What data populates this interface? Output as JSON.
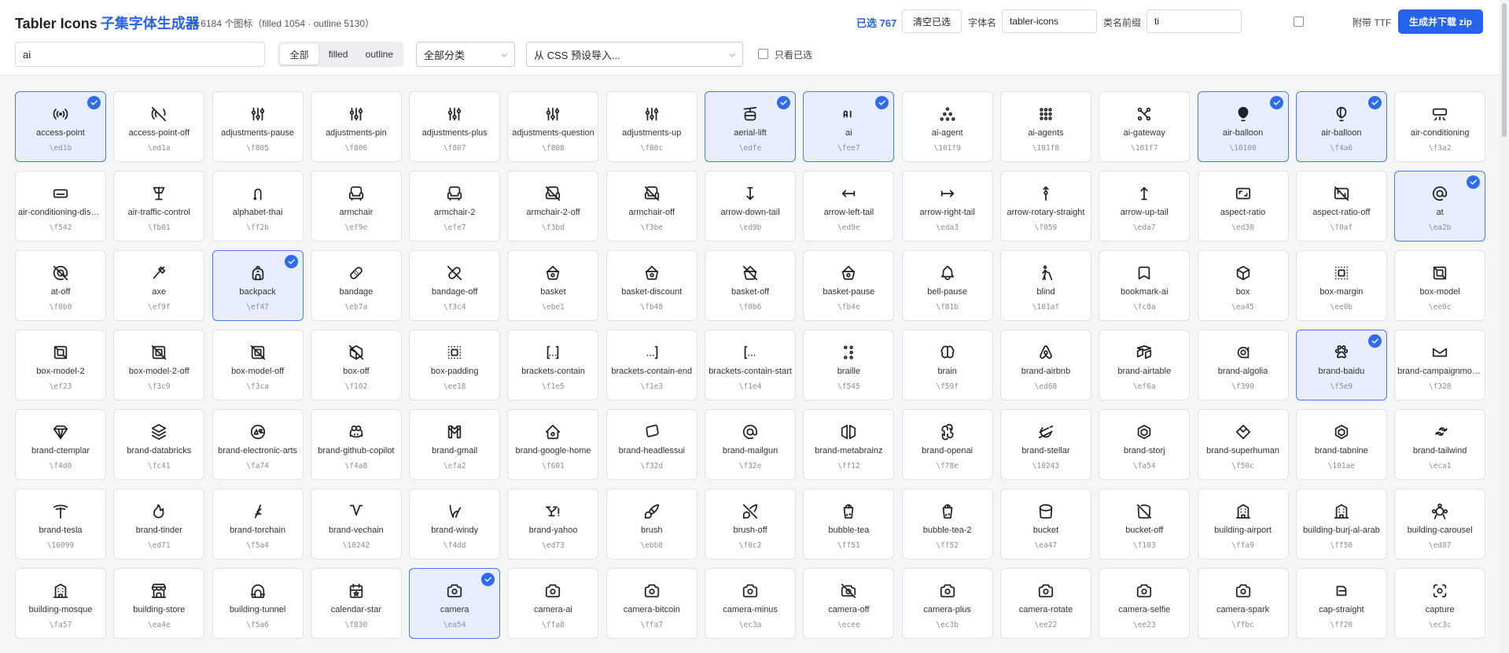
{
  "header": {
    "title": "Tabler Icons",
    "subtitle": "子集字体生成器",
    "count_text": "共 6184 个图标（filled 1054 · outline 5130）",
    "selected_text": "已选 767",
    "clear_label": "清空已选",
    "font_name_label": "字体名",
    "font_name_value": "tabler-icons",
    "class_prefix_label": "类名前缀",
    "class_prefix_value": "ti",
    "ttf_label": "附带 TTF",
    "generate_label": "生成并下载 zip"
  },
  "filters": {
    "search_value": "ai",
    "segments": [
      "全部",
      "filled",
      "outline"
    ],
    "active_segment": "全部",
    "category_value": "全部分类",
    "preset_value": "从 CSS 预设导入...",
    "only_selected_label": "只看已选"
  },
  "icons": [
    {
      "name": "access-point",
      "code": "\\ed1b",
      "selected": true,
      "glyph": "access-point"
    },
    {
      "name": "access-point-off",
      "code": "\\ed1a",
      "selected": false,
      "glyph": "access-point-off"
    },
    {
      "name": "adjustments-pause",
      "code": "\\f805",
      "selected": false,
      "glyph": "adjustments"
    },
    {
      "name": "adjustments-pin",
      "code": "\\f806",
      "selected": false,
      "glyph": "adjustments"
    },
    {
      "name": "adjustments-plus",
      "code": "\\f807",
      "selected": false,
      "glyph": "adjustments"
    },
    {
      "name": "adjustments-question",
      "code": "\\f808",
      "selected": false,
      "glyph": "adjustments"
    },
    {
      "name": "adjustments-up",
      "code": "\\f80c",
      "selected": false,
      "glyph": "adjustments"
    },
    {
      "name": "aerial-lift",
      "code": "\\edfe",
      "selected": true,
      "glyph": "aerial-lift"
    },
    {
      "name": "ai",
      "code": "\\fee7",
      "selected": true,
      "glyph": "ai"
    },
    {
      "name": "ai-agent",
      "code": "\\101f9",
      "selected": false,
      "glyph": "dots-tri"
    },
    {
      "name": "ai-agents",
      "code": "\\101f8",
      "selected": false,
      "glyph": "dots-grid"
    },
    {
      "name": "ai-gateway",
      "code": "\\101f7",
      "selected": false,
      "glyph": "gateway"
    },
    {
      "name": "air-balloon",
      "code": "\\10100",
      "selected": true,
      "glyph": "balloon-filled"
    },
    {
      "name": "air-balloon",
      "code": "\\f4a6",
      "selected": true,
      "glyph": "balloon"
    },
    {
      "name": "air-conditioning",
      "code": "\\f3a2",
      "selected": false,
      "glyph": "aircon"
    },
    {
      "name": "air-conditioning-disabled",
      "code": "\\f542",
      "selected": false,
      "glyph": "aircon-disabled"
    },
    {
      "name": "air-traffic-control",
      "code": "\\fb01",
      "selected": false,
      "glyph": "tower"
    },
    {
      "name": "alphabet-thai",
      "code": "\\ff2b",
      "selected": false,
      "glyph": "thai"
    },
    {
      "name": "armchair",
      "code": "\\ef9e",
      "selected": false,
      "glyph": "armchair"
    },
    {
      "name": "armchair-2",
      "code": "\\efe7",
      "selected": false,
      "glyph": "armchair"
    },
    {
      "name": "armchair-2-off",
      "code": "\\f3bd",
      "selected": false,
      "glyph": "armchair-off"
    },
    {
      "name": "armchair-off",
      "code": "\\f3be",
      "selected": false,
      "glyph": "armchair-off"
    },
    {
      "name": "arrow-down-tail",
      "code": "\\ed9b",
      "selected": false,
      "glyph": "arrow-down-tail"
    },
    {
      "name": "arrow-left-tail",
      "code": "\\ed9e",
      "selected": false,
      "glyph": "arrow-left-tail"
    },
    {
      "name": "arrow-right-tail",
      "code": "\\eda3",
      "selected": false,
      "glyph": "arrow-right-tail"
    },
    {
      "name": "arrow-rotary-straight",
      "code": "\\f059",
      "selected": false,
      "glyph": "arrow-rotary"
    },
    {
      "name": "arrow-up-tail",
      "code": "\\eda7",
      "selected": false,
      "glyph": "arrow-up-tail"
    },
    {
      "name": "aspect-ratio",
      "code": "\\ed30",
      "selected": false,
      "glyph": "aspect-ratio"
    },
    {
      "name": "aspect-ratio-off",
      "code": "\\f0af",
      "selected": false,
      "glyph": "aspect-ratio-off"
    },
    {
      "name": "at",
      "code": "\\ea2b",
      "selected": true,
      "glyph": "at"
    },
    {
      "name": "at-off",
      "code": "\\f0b0",
      "selected": false,
      "glyph": "at-off"
    },
    {
      "name": "axe",
      "code": "\\ef9f",
      "selected": false,
      "glyph": "axe"
    },
    {
      "name": "backpack",
      "code": "\\ef47",
      "selected": true,
      "glyph": "backpack"
    },
    {
      "name": "bandage",
      "code": "\\eb7a",
      "selected": false,
      "glyph": "bandage"
    },
    {
      "name": "bandage-off",
      "code": "\\f3c4",
      "selected": false,
      "glyph": "bandage-off"
    },
    {
      "name": "basket",
      "code": "\\ebe1",
      "selected": false,
      "glyph": "basket"
    },
    {
      "name": "basket-discount",
      "code": "\\fb48",
      "selected": false,
      "glyph": "basket"
    },
    {
      "name": "basket-off",
      "code": "\\f0b6",
      "selected": false,
      "glyph": "basket-off"
    },
    {
      "name": "basket-pause",
      "code": "\\fb4e",
      "selected": false,
      "glyph": "basket"
    },
    {
      "name": "bell-pause",
      "code": "\\f81b",
      "selected": false,
      "glyph": "bell"
    },
    {
      "name": "blind",
      "code": "\\101af",
      "selected": false,
      "glyph": "blind"
    },
    {
      "name": "bookmark-ai",
      "code": "\\fc8a",
      "selected": false,
      "glyph": "bookmark"
    },
    {
      "name": "box",
      "code": "\\ea45",
      "selected": false,
      "glyph": "box"
    },
    {
      "name": "box-margin",
      "code": "\\ee0b",
      "selected": false,
      "glyph": "box-margin"
    },
    {
      "name": "box-model",
      "code": "\\ee0c",
      "selected": false,
      "glyph": "box-model"
    },
    {
      "name": "box-model-2",
      "code": "\\ef23",
      "selected": false,
      "glyph": "box-model"
    },
    {
      "name": "box-model-2-off",
      "code": "\\f3c9",
      "selected": false,
      "glyph": "box-model-off"
    },
    {
      "name": "box-model-off",
      "code": "\\f3ca",
      "selected": false,
      "glyph": "box-model-off"
    },
    {
      "name": "box-off",
      "code": "\\f102",
      "selected": false,
      "glyph": "box-off"
    },
    {
      "name": "box-padding",
      "code": "\\ee18",
      "selected": false,
      "glyph": "box-margin"
    },
    {
      "name": "brackets-contain",
      "code": "\\f1e5",
      "selected": false,
      "glyph": "brackets"
    },
    {
      "name": "brackets-contain-end",
      "code": "\\f1e3",
      "selected": false,
      "glyph": "brackets-end"
    },
    {
      "name": "brackets-contain-start",
      "code": "\\f1e4",
      "selected": false,
      "glyph": "brackets-start"
    },
    {
      "name": "braille",
      "code": "\\f545",
      "selected": false,
      "glyph": "braille"
    },
    {
      "name": "brain",
      "code": "\\f59f",
      "selected": false,
      "glyph": "brain"
    },
    {
      "name": "brand-airbnb",
      "code": "\\ed68",
      "selected": false,
      "glyph": "airbnb"
    },
    {
      "name": "brand-airtable",
      "code": "\\ef6a",
      "selected": false,
      "glyph": "airtable"
    },
    {
      "name": "brand-algolia",
      "code": "\\f390",
      "selected": false,
      "glyph": "algolia"
    },
    {
      "name": "brand-baidu",
      "code": "\\f5e9",
      "selected": true,
      "glyph": "paw"
    },
    {
      "name": "brand-campaignmonitor",
      "code": "\\f328",
      "selected": false,
      "glyph": "envelope"
    },
    {
      "name": "brand-ctemplar",
      "code": "\\f4d0",
      "selected": false,
      "glyph": "shield"
    },
    {
      "name": "brand-databricks",
      "code": "\\fc41",
      "selected": false,
      "glyph": "layers"
    },
    {
      "name": "brand-electronic-arts",
      "code": "\\fa74",
      "selected": false,
      "glyph": "ea"
    },
    {
      "name": "brand-github-copilot",
      "code": "\\f4a8",
      "selected": false,
      "glyph": "copilot"
    },
    {
      "name": "brand-gmail",
      "code": "\\efa2",
      "selected": false,
      "glyph": "gmail"
    },
    {
      "name": "brand-google-home",
      "code": "\\f601",
      "selected": false,
      "glyph": "home"
    },
    {
      "name": "brand-headlessui",
      "code": "\\f32d",
      "selected": false,
      "glyph": "headless"
    },
    {
      "name": "brand-mailgun",
      "code": "\\f32e",
      "selected": false,
      "glyph": "at"
    },
    {
      "name": "brand-metabrainz",
      "code": "\\ff12",
      "selected": false,
      "glyph": "metabrainz"
    },
    {
      "name": "brand-openai",
      "code": "\\f78e",
      "selected": false,
      "glyph": "openai"
    },
    {
      "name": "brand-stellar",
      "code": "\\10243",
      "selected": false,
      "glyph": "stellar"
    },
    {
      "name": "brand-storj",
      "code": "\\fa54",
      "selected": false,
      "glyph": "hex"
    },
    {
      "name": "brand-superhuman",
      "code": "\\f50c",
      "selected": false,
      "glyph": "diamond"
    },
    {
      "name": "brand-tabnine",
      "code": "\\101ae",
      "selected": false,
      "glyph": "hex"
    },
    {
      "name": "brand-tailwind",
      "code": "\\eca1",
      "selected": false,
      "glyph": "tailwind"
    },
    {
      "name": "brand-tesla",
      "code": "\\10099",
      "selected": false,
      "glyph": "tesla"
    },
    {
      "name": "brand-tinder",
      "code": "\\ed71",
      "selected": false,
      "glyph": "flame"
    },
    {
      "name": "brand-torchain",
      "code": "\\f5a4",
      "selected": false,
      "glyph": "torchain"
    },
    {
      "name": "brand-vechain",
      "code": "\\10242",
      "selected": false,
      "glyph": "vechain"
    },
    {
      "name": "brand-windy",
      "code": "\\f4dd",
      "selected": false,
      "glyph": "windy"
    },
    {
      "name": "brand-yahoo",
      "code": "\\ed73",
      "selected": false,
      "glyph": "yahoo"
    },
    {
      "name": "brush",
      "code": "\\ebb8",
      "selected": false,
      "glyph": "brush"
    },
    {
      "name": "brush-off",
      "code": "\\f0c2",
      "selected": false,
      "glyph": "brush-off"
    },
    {
      "name": "bubble-tea",
      "code": "\\ff51",
      "selected": false,
      "glyph": "cup"
    },
    {
      "name": "bubble-tea-2",
      "code": "\\ff52",
      "selected": false,
      "glyph": "cup"
    },
    {
      "name": "bucket",
      "code": "\\ea47",
      "selected": false,
      "glyph": "bucket"
    },
    {
      "name": "bucket-off",
      "code": "\\f103",
      "selected": false,
      "glyph": "bucket-off"
    },
    {
      "name": "building-airport",
      "code": "\\ffa9",
      "selected": false,
      "glyph": "building"
    },
    {
      "name": "building-burj-al-arab",
      "code": "\\ff50",
      "selected": false,
      "glyph": "building"
    },
    {
      "name": "building-carousel",
      "code": "\\ed87",
      "selected": false,
      "glyph": "carousel"
    },
    {
      "name": "building-mosque",
      "code": "\\fa57",
      "selected": false,
      "glyph": "building"
    },
    {
      "name": "building-store",
      "code": "\\ea4e",
      "selected": false,
      "glyph": "store"
    },
    {
      "name": "building-tunnel",
      "code": "\\f5a6",
      "selected": false,
      "glyph": "tunnel"
    },
    {
      "name": "calendar-star",
      "code": "\\f830",
      "selected": false,
      "glyph": "calendar"
    },
    {
      "name": "camera",
      "code": "\\ea54",
      "selected": true,
      "glyph": "camera"
    },
    {
      "name": "camera-ai",
      "code": "\\ffa8",
      "selected": false,
      "glyph": "camera"
    },
    {
      "name": "camera-bitcoin",
      "code": "\\ffa7",
      "selected": false,
      "glyph": "camera"
    },
    {
      "name": "camera-minus",
      "code": "\\ec3a",
      "selected": false,
      "glyph": "camera"
    },
    {
      "name": "camera-off",
      "code": "\\ecee",
      "selected": false,
      "glyph": "camera-off"
    },
    {
      "name": "camera-plus",
      "code": "\\ec3b",
      "selected": false,
      "glyph": "camera"
    },
    {
      "name": "camera-rotate",
      "code": "\\ee22",
      "selected": false,
      "glyph": "camera"
    },
    {
      "name": "camera-selfie",
      "code": "\\ee23",
      "selected": false,
      "glyph": "camera"
    },
    {
      "name": "camera-spark",
      "code": "\\ffbc",
      "selected": false,
      "glyph": "camera"
    },
    {
      "name": "cap-straight",
      "code": "\\ff20",
      "selected": false,
      "glyph": "cap"
    },
    {
      "name": "capture",
      "code": "\\ec3c",
      "selected": false,
      "glyph": "capture"
    }
  ],
  "colors": {
    "accent": "#2563eb",
    "selected_bg": "#e8eeff",
    "selected_border": "#4a7bf0",
    "check_bg": "#2f6bef"
  }
}
